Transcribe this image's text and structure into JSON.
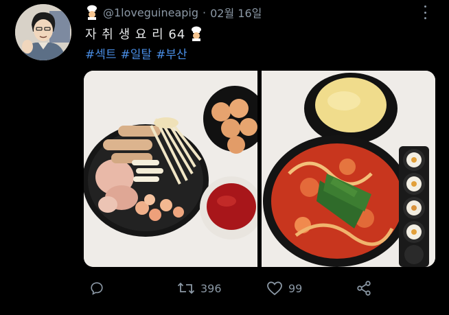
{
  "tweet": {
    "handle": "@1loveguineapig",
    "separator": "·",
    "date": "02월 16일",
    "title": "자 취 생 요 리 64",
    "hashtags": [
      "#섹트",
      "#일탈",
      "#부산"
    ],
    "colors": {
      "background": "#000000",
      "text": "#e7e9ea",
      "muted": "#8b98a5",
      "link": "#4a8fe7"
    }
  },
  "actions": {
    "reply_icon": "reply-icon",
    "retweet_icon": "retweet-icon",
    "retweet_count": "396",
    "like_icon": "heart-icon",
    "like_count": "99",
    "share_icon": "share-icon"
  }
}
